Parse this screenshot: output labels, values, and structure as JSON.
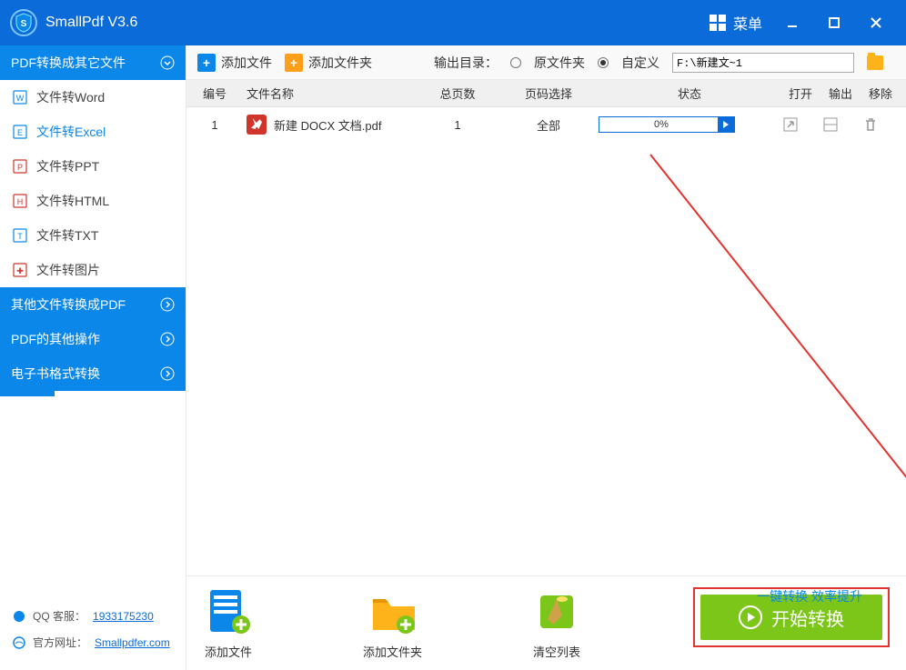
{
  "title": "SmallPdf V3.6",
  "menu": "菜单",
  "sidebar": {
    "groups": [
      {
        "label": "PDF转换成其它文件",
        "items": [
          {
            "icon": "W",
            "color": "#0b87ea",
            "label": "文件转Word"
          },
          {
            "icon": "E",
            "color": "#0b87ea",
            "label": "文件转Excel",
            "active": true
          },
          {
            "icon": "P",
            "color": "#d0342a",
            "label": "文件转PPT"
          },
          {
            "icon": "H",
            "color": "#d0342a",
            "label": "文件转HTML"
          },
          {
            "icon": "T",
            "color": "#0b87ea",
            "label": "文件转TXT"
          },
          {
            "icon": "✚",
            "color": "#d0342a",
            "label": "文件转图片"
          }
        ]
      },
      {
        "label": "其他文件转换成PDF"
      },
      {
        "label": "PDF的其他操作"
      },
      {
        "label": "电子书格式转换"
      }
    ],
    "qq_label": "QQ 客服：",
    "qq_value": "1933175230",
    "site_label": "官方网址：",
    "site_value": "Smallpdfer.com"
  },
  "toolbar": {
    "add_file": "添加文件",
    "add_folder": "添加文件夹",
    "output_label": "输出目录：",
    "radio_source": "原文件夹",
    "radio_custom": "自定义",
    "output_path": "F:\\新建文~1"
  },
  "columns": {
    "index": "编号",
    "name": "文件名称",
    "pages": "总页数",
    "range": "页码选择",
    "status": "状态",
    "open": "打开",
    "export": "输出",
    "remove": "移除"
  },
  "rows": [
    {
      "index": "1",
      "name": "新建 DOCX 文档.pdf",
      "pages": "1",
      "range": "全部",
      "progress": "0%"
    }
  ],
  "bottom": {
    "add_file": "添加文件",
    "add_folder": "添加文件夹",
    "clear_list": "清空列表",
    "hint": "一键转换   效率提升",
    "start": "开始转换"
  }
}
